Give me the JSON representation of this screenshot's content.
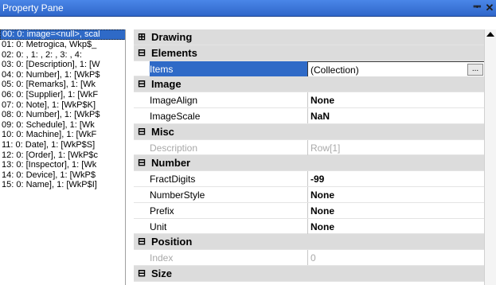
{
  "window": {
    "title": "Property Pane",
    "pin_glyph": "ᆍ",
    "close_glyph": "✕"
  },
  "list": {
    "items": [
      "00: 0: image=<null>, scal",
      "01: 0: Metrogica, Wkp$_",
      "02: 0: , 1: , 2: , 3: , 4:",
      "03: 0: [Description], 1: [W",
      "04: 0: Number], 1: [WkP$",
      "05: 0: [Remarks], 1: [Wk",
      "06: 0: [Supplier], 1: [WkF",
      "07: 0: Note], 1: [WkP$K]",
      "08: 0: Number], 1: [WkP$",
      "09: 0: Schedule], 1: [Wk",
      "10: 0: Machine], 1: [WkF",
      "11: 0: Date], 1: [WkP$S]",
      "12: 0: [Order], 1: [WkP$c",
      "13: 0: [Inspector], 1: [Wk",
      "14: 0: Device], 1: [WkP$",
      "15: 0: Name], 1: [WkP$I]"
    ],
    "selected_index": 0
  },
  "grid": {
    "rows": [
      {
        "type": "category",
        "toggle": "⊞",
        "label": "Drawing"
      },
      {
        "type": "category",
        "toggle": "⊟",
        "label": "Elements"
      },
      {
        "type": "property",
        "name": "Items",
        "value": "(Collection)",
        "selected": true,
        "ellipsis": "..."
      },
      {
        "type": "category",
        "toggle": "⊟",
        "label": "Image"
      },
      {
        "type": "property",
        "name": "ImageAlign",
        "value": "None",
        "bold": true
      },
      {
        "type": "property",
        "name": "ImageScale",
        "value": "NaN",
        "bold": true
      },
      {
        "type": "category",
        "toggle": "⊟",
        "label": "Misc"
      },
      {
        "type": "property",
        "name": "Description",
        "value": "Row[1]",
        "disabled": true
      },
      {
        "type": "category",
        "toggle": "⊟",
        "label": "Number"
      },
      {
        "type": "property",
        "name": "FractDigits",
        "value": "-99",
        "bold": true
      },
      {
        "type": "property",
        "name": "NumberStyle",
        "value": "None",
        "bold": true
      },
      {
        "type": "property",
        "name": "Prefix",
        "value": "None",
        "bold": true
      },
      {
        "type": "property",
        "name": "Unit",
        "value": "None",
        "bold": true
      },
      {
        "type": "category",
        "toggle": "⊟",
        "label": "Position"
      },
      {
        "type": "property",
        "name": "Index",
        "value": "0",
        "disabled": true
      },
      {
        "type": "category",
        "toggle": "⊟",
        "label": "Size"
      }
    ]
  }
}
